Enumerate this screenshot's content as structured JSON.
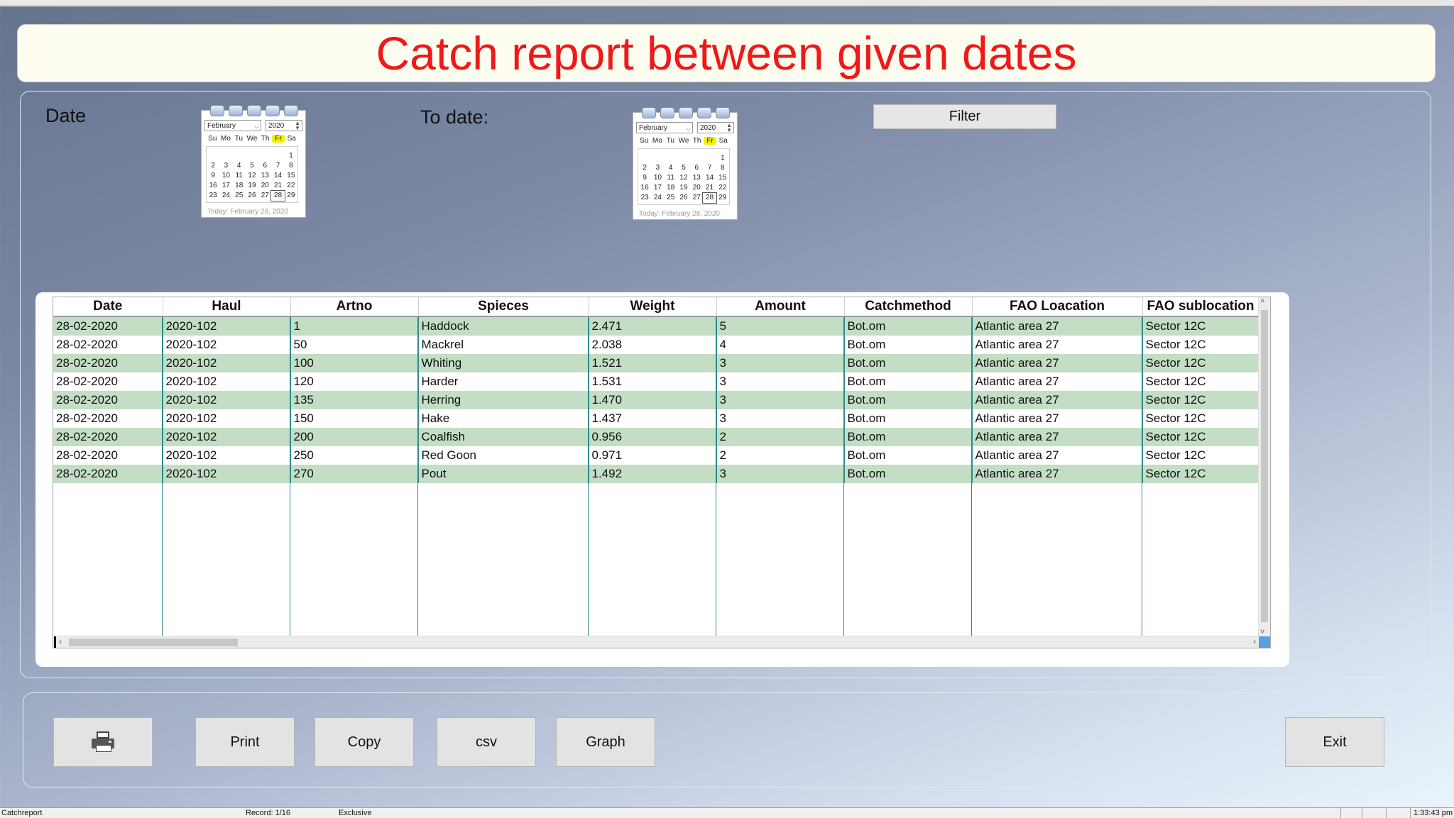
{
  "title": "Catch report between given dates",
  "filters": {
    "date_label": "Date",
    "to_date_label": "To date:",
    "filter_button": "Filter"
  },
  "calendar_from": {
    "month": "February",
    "year": "2020",
    "weekdays": [
      "Su",
      "Mo",
      "Tu",
      "We",
      "Th",
      "Fr",
      "Sa"
    ],
    "highlight_weekday": "Fr",
    "weeks": [
      [
        "",
        "",
        "",
        "",
        "",
        "",
        "1"
      ],
      [
        "2",
        "3",
        "4",
        "5",
        "6",
        "7",
        "8"
      ],
      [
        "9",
        "10",
        "11",
        "12",
        "13",
        "14",
        "15"
      ],
      [
        "16",
        "17",
        "18",
        "19",
        "20",
        "21",
        "22"
      ],
      [
        "23",
        "24",
        "25",
        "26",
        "27",
        "28",
        "29"
      ]
    ],
    "selected_day": "28",
    "today": "Today: February 28, 2020"
  },
  "calendar_to": {
    "month": "February",
    "year": "2020",
    "weekdays": [
      "Su",
      "Mo",
      "Tu",
      "We",
      "Th",
      "Fr",
      "Sa"
    ],
    "highlight_weekday": "Fr",
    "weeks": [
      [
        "",
        "",
        "",
        "",
        "",
        "",
        "1"
      ],
      [
        "2",
        "3",
        "4",
        "5",
        "6",
        "7",
        "8"
      ],
      [
        "9",
        "10",
        "11",
        "12",
        "13",
        "14",
        "15"
      ],
      [
        "16",
        "17",
        "18",
        "19",
        "20",
        "21",
        "22"
      ],
      [
        "23",
        "24",
        "25",
        "26",
        "27",
        "28",
        "29"
      ]
    ],
    "selected_day": "28",
    "today": "Today: February 28, 2020"
  },
  "table": {
    "columns": [
      "Date",
      "Haul",
      "Artno",
      "Spieces",
      "Weight",
      "Amount",
      "Catchmethod",
      "FAO Loacation",
      "FAO sublocation"
    ],
    "rows": [
      [
        "28-02-2020",
        "2020-102",
        "1",
        "Haddock",
        "2.471",
        "5",
        "Bot.om",
        "Atlantic area 27",
        "Sector 12C"
      ],
      [
        "28-02-2020",
        "2020-102",
        "50",
        "Mackrel",
        "2.038",
        "4",
        "Bot.om",
        "Atlantic area 27",
        "Sector 12C"
      ],
      [
        "28-02-2020",
        "2020-102",
        "100",
        "Whiting",
        "1.521",
        "3",
        "Bot.om",
        "Atlantic area 27",
        "Sector 12C"
      ],
      [
        "28-02-2020",
        "2020-102",
        "120",
        "Harder",
        "1.531",
        "3",
        "Bot.om",
        "Atlantic area 27",
        "Sector 12C"
      ],
      [
        "28-02-2020",
        "2020-102",
        "135",
        "Herring",
        "1.470",
        "3",
        "Bot.om",
        "Atlantic area 27",
        "Sector 12C"
      ],
      [
        "28-02-2020",
        "2020-102",
        "150",
        "Hake",
        "1.437",
        "3",
        "Bot.om",
        "Atlantic area 27",
        "Sector 12C"
      ],
      [
        "28-02-2020",
        "2020-102",
        "200",
        "Coalfish",
        "0.956",
        "2",
        "Bot.om",
        "Atlantic area 27",
        "Sector 12C"
      ],
      [
        "28-02-2020",
        "2020-102",
        "250",
        "Red Goon",
        "0.971",
        "2",
        "Bot.om",
        "Atlantic area 27",
        "Sector 12C"
      ],
      [
        "28-02-2020",
        "2020-102",
        "270",
        "Pout",
        "1.492",
        "3",
        "Bot.om",
        "Atlantic area 27",
        "Sector 12C"
      ]
    ]
  },
  "buttons": {
    "printer_icon": "printer-icon",
    "print": "Print",
    "copy": "Copy",
    "csv": "csv",
    "graph": "Graph",
    "exit": "Exit"
  },
  "statusbar": {
    "form_name": "Catchreport",
    "record": "Record: 1/16",
    "mode": "Exclusive",
    "time": "1:33:43 pm"
  },
  "colors": {
    "title_text": "#f01818",
    "row_alt": "#c3dec5",
    "weekday_highlight": "#f4f000",
    "grid_lines": "#2e8b8b"
  }
}
